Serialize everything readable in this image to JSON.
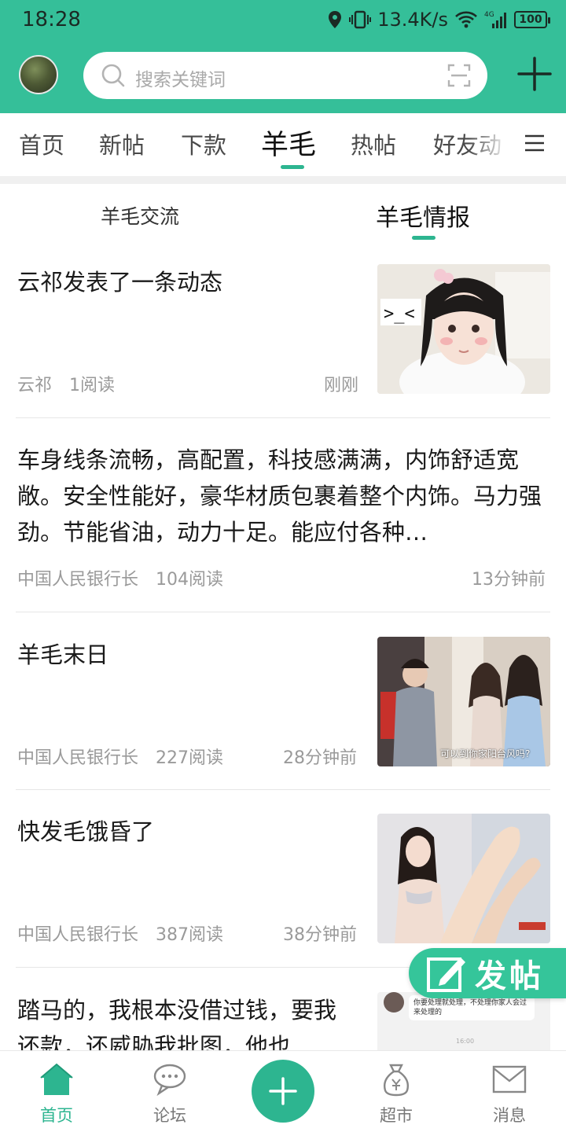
{
  "statusbar": {
    "time": "18:28",
    "speed": "13.4K/s",
    "battery": "100",
    "network": "4G"
  },
  "header": {
    "search_placeholder": "搜索关键词"
  },
  "tabs": [
    {
      "label": "首页"
    },
    {
      "label": "新帖"
    },
    {
      "label": "下款"
    },
    {
      "label": "羊毛",
      "active": true
    },
    {
      "label": "热帖"
    },
    {
      "label": "好友动"
    }
  ],
  "subtabs": [
    {
      "label": "羊毛交流"
    },
    {
      "label": "羊毛情报",
      "active": true
    }
  ],
  "posts": [
    {
      "title": "云祁发表了一条动态",
      "author": "云祁",
      "reads": "1阅读",
      "time": "刚刚",
      "has_thumb": true
    },
    {
      "title": "车身线条流畅，高配置，科技感满满，内饰舒适宽敞。安全性能好，豪华材质包裹着整个内饰。马力强劲。节能省油，动力十足。能应付各种…",
      "author": "中国人民银行长",
      "reads": "104阅读",
      "time": "13分钟前",
      "has_thumb": false
    },
    {
      "title": "羊毛末日",
      "author": "中国人民银行长",
      "reads": "227阅读",
      "time": "28分钟前",
      "has_thumb": true,
      "thumb_caption": "可以到你家阳台风吗?"
    },
    {
      "title": "快发毛饿昏了",
      "author": "中国人民银行长",
      "reads": "387阅读",
      "time": "38分钟前",
      "has_thumb": true
    },
    {
      "title": "踏马的，我根本没借过钱，要我还款，还威胁我批图，他也",
      "has_thumb": true,
      "thumb_chat": "你要处理就处理，不处理你家人会过来处理的",
      "thumb_time": "16:00"
    }
  ],
  "fab": {
    "label": "发帖"
  },
  "bottomnav": [
    {
      "label": "首页",
      "icon": "home-icon",
      "active": true
    },
    {
      "label": "论坛",
      "icon": "chat-bubble-icon"
    },
    {
      "label": "",
      "icon": "plus-icon"
    },
    {
      "label": "超市",
      "icon": "money-bag-icon"
    },
    {
      "label": "消息",
      "icon": "mail-icon"
    }
  ],
  "colors": {
    "accent": "#35bf99",
    "active_green": "#2db590"
  }
}
